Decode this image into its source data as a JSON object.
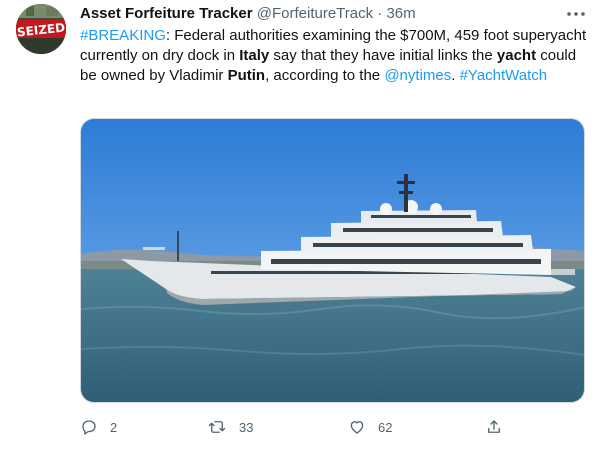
{
  "account": {
    "name": "Asset Forfeiture Tracker",
    "handle": "@ForfeitureTrack",
    "separator": "·",
    "time": "36m",
    "avatar_text": "SEIZED"
  },
  "tweet": {
    "segments": [
      {
        "text": "#BREAKING",
        "style": "link"
      },
      {
        "text": ": Federal authorities examining the $700M, 459 foot superyacht currently on dry dock in ",
        "style": "plain"
      },
      {
        "text": "Italy",
        "style": "bold"
      },
      {
        "text": " say that they have initial links the ",
        "style": "plain"
      },
      {
        "text": "yacht",
        "style": "bold"
      },
      {
        "text": " could be owned by Vladimir ",
        "style": "plain"
      },
      {
        "text": "Putin",
        "style": "bold"
      },
      {
        "text": ", according to the ",
        "style": "plain"
      },
      {
        "text": "@nytimes",
        "style": "link"
      },
      {
        "text": ". ",
        "style": "plain"
      },
      {
        "text": "#YachtWatch",
        "style": "link"
      }
    ]
  },
  "actions": {
    "reply_count": "2",
    "retweet_count": "33",
    "like_count": "62"
  },
  "icons": {
    "more": "more-dots-icon",
    "reply": "reply-icon",
    "retweet": "retweet-icon",
    "like": "heart-icon",
    "share": "share-icon"
  },
  "colors": {
    "link": "#1d9bf0",
    "secondary": "#536471",
    "text": "#0f1419"
  }
}
